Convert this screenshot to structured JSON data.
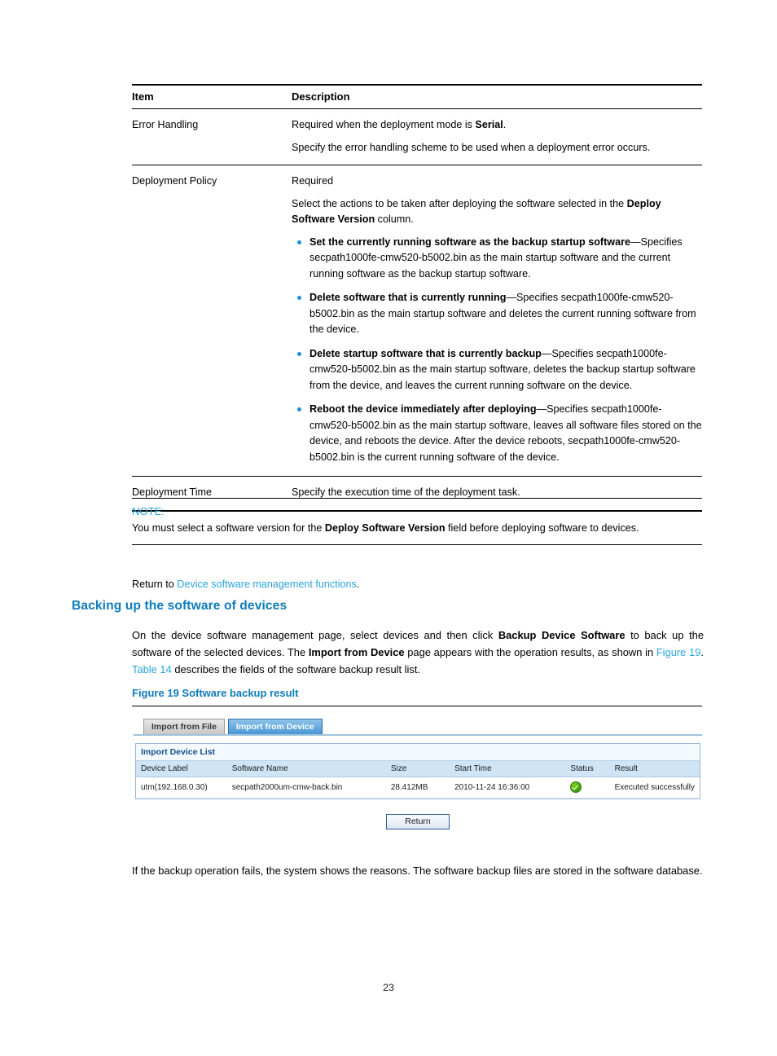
{
  "table": {
    "headers": {
      "item": "Item",
      "description": "Description"
    },
    "rows": [
      {
        "item": "Error Handling",
        "desc_lines": [
          {
            "pre": "Required when the deployment mode is ",
            "bold": "Serial",
            "post": "."
          },
          {
            "pre": "Specify the error handling scheme to be used when a deployment error occurs.",
            "bold": "",
            "post": ""
          }
        ]
      },
      {
        "item": "Deployment Policy",
        "intro1": "Required",
        "intro2_pre": "Select the actions to be taken after deploying the software selected in the ",
        "intro2_bold": "Deploy Software Version",
        "intro2_post": " column.",
        "bullets": [
          {
            "bold": "Set the currently running software as the backup startup software",
            "rest": "—Specifies secpath1000fe-cmw520-b5002.bin as the main startup software and the current running software as the backup startup software."
          },
          {
            "bold": "Delete software that is currently running",
            "rest": "—Specifies secpath1000fe-cmw520-b5002.bin as the main startup software and deletes the current running software from the device."
          },
          {
            "bold": "Delete startup software that is currently backup",
            "rest": "—Specifies secpath1000fe-cmw520-b5002.bin as the main startup software, deletes the backup startup software from the device, and leaves the current running software on the device."
          },
          {
            "bold": "Reboot the device immediately after deploying",
            "rest": "—Specifies secpath1000fe-cmw520-b5002.bin as the main startup software, leaves all software files stored on the device, and reboots the device. After the device reboots, secpath1000fe-cmw520-b5002.bin is the current running software of the device."
          }
        ]
      },
      {
        "item": "Deployment Time",
        "desc_lines": [
          {
            "pre": "Specify the execution time of the deployment task.",
            "bold": "",
            "post": ""
          }
        ]
      }
    ]
  },
  "note": {
    "label": "NOTE:",
    "body_pre": "You must select a software version for the ",
    "body_bold": "Deploy Software Version",
    "body_post": " field before deploying software to devices."
  },
  "return_line": {
    "pre": "Return to ",
    "link": "Device software management functions",
    "post": "."
  },
  "section": {
    "heading": "Backing up the software of devices",
    "paragraph": {
      "p1": "On the device software management page, select devices and then click ",
      "b1": "Backup Device Software",
      "p2": " to back up the software of the selected devices. The ",
      "b2": "Import from Device",
      "p3": " page appears with the operation results, as shown in ",
      "link1": "Figure 19",
      "p4": ". ",
      "link2": "Table 14",
      "p5": " describes the fields of the software backup result list."
    },
    "figure_caption": "Figure 19 Software backup result"
  },
  "screenshot": {
    "tabs": [
      {
        "label": "Import from File",
        "active": false
      },
      {
        "label": "Import from Device",
        "active": true
      }
    ],
    "panel_title": "Import Device List",
    "columns": [
      "Device Label",
      "Software Name",
      "Size",
      "Start Time",
      "Status",
      "Result"
    ],
    "rows": [
      {
        "device_label": "utm(192.168.0.30)",
        "software_name": "secpath2000um-cmw-back.bin",
        "size": "28.412MB",
        "start_time": "2010-11-24 16:36:00",
        "status_icon": "success-check-icon",
        "result": "Executed successfully"
      }
    ],
    "return_button": "Return"
  },
  "tail_paragraph": "If the backup operation fails, the system shows the reasons. The software backup files are stored in the software database.",
  "page_number": "23",
  "colors": {
    "heading_blue": "#0d7cba",
    "link_blue": "#29a3dc",
    "bullet_blue": "#1a8fd1",
    "status_green": "#3f9c0a",
    "table_header_bg": "#cfe4f5"
  }
}
